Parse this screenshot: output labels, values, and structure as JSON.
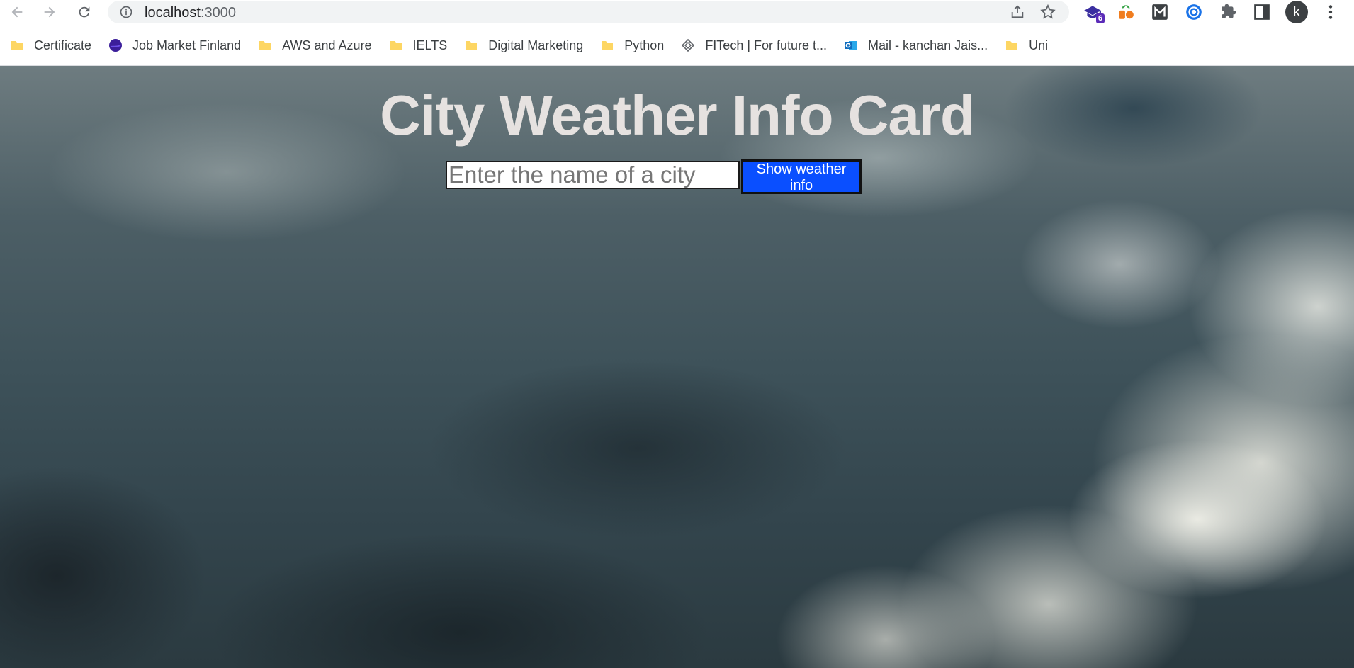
{
  "browser": {
    "url_host": "localhost",
    "url_port": ":3000",
    "profile_initial": "k",
    "extension_badge": "6"
  },
  "bookmarks": [
    {
      "label": "Certificate",
      "icon": "folder-icon"
    },
    {
      "label": "Job Market Finland",
      "icon": "site-favicon-icon"
    },
    {
      "label": "AWS and Azure",
      "icon": "folder-icon"
    },
    {
      "label": "IELTS",
      "icon": "folder-icon"
    },
    {
      "label": "Digital Marketing",
      "icon": "folder-icon"
    },
    {
      "label": "Python",
      "icon": "folder-icon"
    },
    {
      "label": "FITech | For future t...",
      "icon": "fitech-favicon-icon"
    },
    {
      "label": "Mail - kanchan Jais...",
      "icon": "outlook-icon"
    },
    {
      "label": "Uni",
      "icon": "folder-icon"
    }
  ],
  "page": {
    "title": "City Weather Info Card",
    "search_placeholder": "Enter the name of a city",
    "search_value": "",
    "button_label": "Show weather info"
  },
  "colors": {
    "button_bg": "#0a4fff",
    "title_color": "#e6e2e0",
    "folder": "#fdd663"
  }
}
